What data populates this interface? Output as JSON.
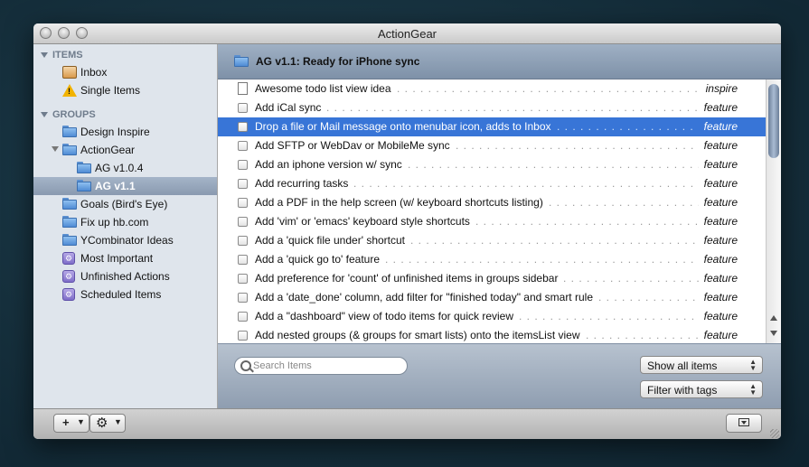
{
  "window": {
    "title": "ActionGear"
  },
  "sidebar": {
    "items_header": "ITEMS",
    "items": [
      {
        "label": "Inbox",
        "icon": "inbox-icon"
      },
      {
        "label": "Single Items",
        "icon": "warning-icon"
      }
    ],
    "groups_header": "GROUPS",
    "groups": [
      {
        "label": "Design Inspire",
        "icon": "folder-icon",
        "indent": 0
      },
      {
        "label": "ActionGear",
        "icon": "folder-icon",
        "indent": 0,
        "expanded": true
      },
      {
        "label": "AG v1.0.4",
        "icon": "folder-icon",
        "indent": 1
      },
      {
        "label": "AG v1.1",
        "icon": "folder-icon",
        "indent": 1,
        "selected": true
      },
      {
        "label": "Goals (Bird's Eye)",
        "icon": "folder-icon",
        "indent": 0
      },
      {
        "label": "Fix up hb.com",
        "icon": "folder-icon",
        "indent": 0
      },
      {
        "label": "YCombinator Ideas",
        "icon": "folder-icon",
        "indent": 0
      },
      {
        "label": "Most Important",
        "icon": "smart-folder-icon",
        "indent": 0
      },
      {
        "label": "Unfinished Actions",
        "icon": "smart-folder-icon",
        "indent": 0
      },
      {
        "label": "Scheduled Items",
        "icon": "smart-folder-icon",
        "indent": 0
      }
    ]
  },
  "header": {
    "title": "AG v1.1: Ready for iPhone sync"
  },
  "items": [
    {
      "text": "Awesome todo list view idea",
      "tag": "inspire",
      "icon": "document-icon"
    },
    {
      "text": "Add iCal sync",
      "tag": "feature"
    },
    {
      "text": "Drop a file or Mail message onto menubar icon, adds to Inbox",
      "tag": "feature",
      "selected": true
    },
    {
      "text": "Add SFTP or WebDav or MobileMe sync",
      "tag": "feature"
    },
    {
      "text": "Add an iphone version w/ sync",
      "tag": "feature"
    },
    {
      "text": "Add recurring tasks",
      "tag": "feature"
    },
    {
      "text": "Add a PDF in the help screen (w/ keyboard shortcuts listing)",
      "tag": "feature"
    },
    {
      "text": "Add 'vim' or 'emacs' keyboard style shortcuts",
      "tag": "feature"
    },
    {
      "text": "Add a 'quick file under' shortcut",
      "tag": "feature"
    },
    {
      "text": "Add a 'quick go to' feature",
      "tag": "feature"
    },
    {
      "text": "Add preference for 'count' of unfinished items in groups sidebar",
      "tag": "feature"
    },
    {
      "text": "Add a 'date_done' column, add filter for \"finished today\" and smart rule",
      "tag": "feature"
    },
    {
      "text": "Add a \"dashboard\" view of todo items for quick review",
      "tag": "feature"
    },
    {
      "text": "Add nested groups (& groups for smart lists) onto the itemsList view",
      "tag": "feature"
    }
  ],
  "search": {
    "placeholder": "Search Items"
  },
  "filters": {
    "show": "Show all items",
    "tags": "Filter with tags"
  },
  "footer": {
    "add_label": "+",
    "action_icon": "gear-icon",
    "toggle_icon": "drawer-toggle-icon"
  },
  "colors": {
    "selection": "#3875d7",
    "header_bar": "#8fa1b7",
    "sidebar_bg": "#dfe5ec"
  }
}
